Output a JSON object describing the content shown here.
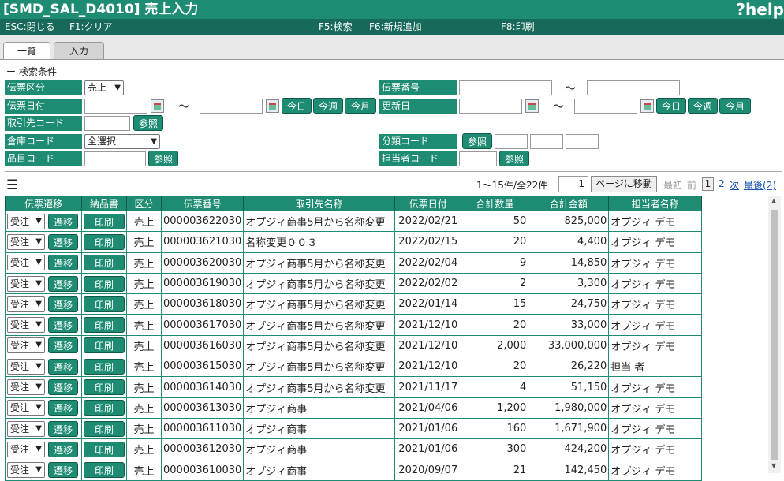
{
  "header": {
    "title": "[SMD_SAL_D4010] 売上入力",
    "help_label": "?help"
  },
  "fkeys": {
    "esc": "ESC:閉じる",
    "f1": "F1:クリア",
    "f5": "F5:検索",
    "f6": "F6:新規追加",
    "f8": "F8:印刷"
  },
  "tabs": [
    {
      "label": "一覧",
      "active": true
    },
    {
      "label": "入力",
      "active": false
    }
  ],
  "search": {
    "section_label": "ー 検索条件",
    "denpyo_kubun": {
      "label": "伝票区分",
      "value": "売上"
    },
    "denpyo_date": {
      "label": "伝票日付",
      "from": "",
      "to": ""
    },
    "torihiki_code": {
      "label": "取引先コード",
      "value": ""
    },
    "souko_code": {
      "label": "倉庫コード",
      "value": "全選択"
    },
    "hinmoku_code": {
      "label": "品目コード",
      "value": ""
    },
    "denpyo_no": {
      "label": "伝票番号",
      "from": "",
      "to": ""
    },
    "koushin_date": {
      "label": "更新日",
      "from": "",
      "to": ""
    },
    "bunrui_code": {
      "label": "分類コード",
      "v1": "",
      "v2": "",
      "v3": ""
    },
    "tantou_code": {
      "label": "担当者コード",
      "value": ""
    },
    "tilde": "～",
    "btn_today": "今日",
    "btn_week": "今週",
    "btn_month": "今月",
    "btn_ref": "参照"
  },
  "pager": {
    "summary": "1～15件/全22件",
    "page_input": "1",
    "goto_label": "ページに移動",
    "first": "最初",
    "prev": "前",
    "current": "1",
    "page2": "2",
    "next": "次",
    "last": "最後(2)"
  },
  "table": {
    "headers": [
      "伝票遷移",
      "納品書",
      "区分",
      "伝票番号",
      "取引先名称",
      "伝票日付",
      "合計数量",
      "合計金額",
      "担当者名称"
    ],
    "select_value": "受注",
    "move_label": "遷移",
    "print_label": "印刷",
    "rows": [
      {
        "kubun": "売上",
        "no": "000003622030",
        "name": "オプジィ商事5月から名称変更",
        "date": "2022/02/21",
        "qty": "50",
        "amount": "825,000",
        "staff": "オプジィ デモ"
      },
      {
        "kubun": "売上",
        "no": "000003621030",
        "name": "名称変更００３",
        "date": "2022/02/15",
        "qty": "20",
        "amount": "4,400",
        "staff": "オプジィ デモ"
      },
      {
        "kubun": "売上",
        "no": "000003620030",
        "name": "オプジィ商事5月から名称変更",
        "date": "2022/02/04",
        "qty": "9",
        "amount": "14,850",
        "staff": "オプジィ デモ"
      },
      {
        "kubun": "売上",
        "no": "000003619030",
        "name": "オプジィ商事5月から名称変更",
        "date": "2022/02/02",
        "qty": "2",
        "amount": "3,300",
        "staff": "オプジィ デモ"
      },
      {
        "kubun": "売上",
        "no": "000003618030",
        "name": "オプジィ商事5月から名称変更",
        "date": "2022/01/14",
        "qty": "15",
        "amount": "24,750",
        "staff": "オプジィ デモ"
      },
      {
        "kubun": "売上",
        "no": "000003617030",
        "name": "オプジィ商事5月から名称変更",
        "date": "2021/12/10",
        "qty": "20",
        "amount": "33,000",
        "staff": "オプジィ デモ"
      },
      {
        "kubun": "売上",
        "no": "000003616030",
        "name": "オプジィ商事5月から名称変更",
        "date": "2021/12/10",
        "qty": "2,000",
        "amount": "33,000,000",
        "staff": "オプジィ デモ"
      },
      {
        "kubun": "売上",
        "no": "000003615030",
        "name": "オプジィ商事5月から名称変更",
        "date": "2021/12/10",
        "qty": "20",
        "amount": "26,220",
        "staff": "担当 者"
      },
      {
        "kubun": "売上",
        "no": "000003614030",
        "name": "オプジィ商事5月から名称変更",
        "date": "2021/11/17",
        "qty": "4",
        "amount": "51,150",
        "staff": "オプジィ デモ"
      },
      {
        "kubun": "売上",
        "no": "000003613030",
        "name": "オプジィ商事",
        "date": "2021/04/06",
        "qty": "1,200",
        "amount": "1,980,000",
        "staff": "オプジィ デモ"
      },
      {
        "kubun": "売上",
        "no": "000003611030",
        "name": "オプジィ商事",
        "date": "2021/01/06",
        "qty": "160",
        "amount": "1,671,900",
        "staff": "オプジィ デモ"
      },
      {
        "kubun": "売上",
        "no": "000003612030",
        "name": "オプジィ商事",
        "date": "2021/01/06",
        "qty": "300",
        "amount": "424,200",
        "staff": "オプジィ デモ"
      },
      {
        "kubun": "売上",
        "no": "000003610030",
        "name": "オプジィ商事",
        "date": "2020/09/07",
        "qty": "21",
        "amount": "142,450",
        "staff": "オプジィ デモ"
      }
    ]
  },
  "colors": {
    "accent": "#1e8c72",
    "accent_dark": "#17695a"
  }
}
